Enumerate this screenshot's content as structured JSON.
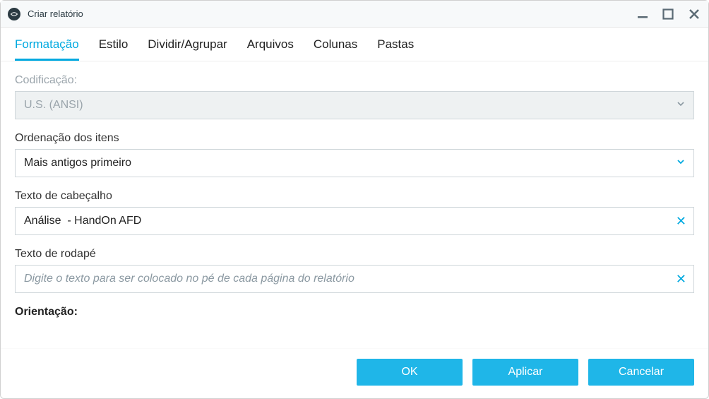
{
  "window": {
    "title": "Criar relatório"
  },
  "tabs": [
    {
      "label": "Formatação",
      "active": true
    },
    {
      "label": "Estilo",
      "active": false
    },
    {
      "label": "Dividir/Agrupar",
      "active": false
    },
    {
      "label": "Arquivos",
      "active": false
    },
    {
      "label": "Colunas",
      "active": false
    },
    {
      "label": "Pastas",
      "active": false
    }
  ],
  "form": {
    "encoding_label": "Codificação:",
    "encoding_value": "U.S. (ANSI)",
    "ordering_label": "Ordenação dos itens",
    "ordering_value": "Mais antigos primeiro",
    "header_label": "Texto de cabeçalho",
    "header_value": "Análise  - HandOn AFD",
    "footer_label": "Texto de rodapé",
    "footer_value": "",
    "footer_placeholder": "Digite o texto para ser colocado no pé de cada página do relatório",
    "orientation_label": "Orientação:"
  },
  "buttons": {
    "ok": "OK",
    "apply": "Aplicar",
    "cancel": "Cancelar"
  }
}
